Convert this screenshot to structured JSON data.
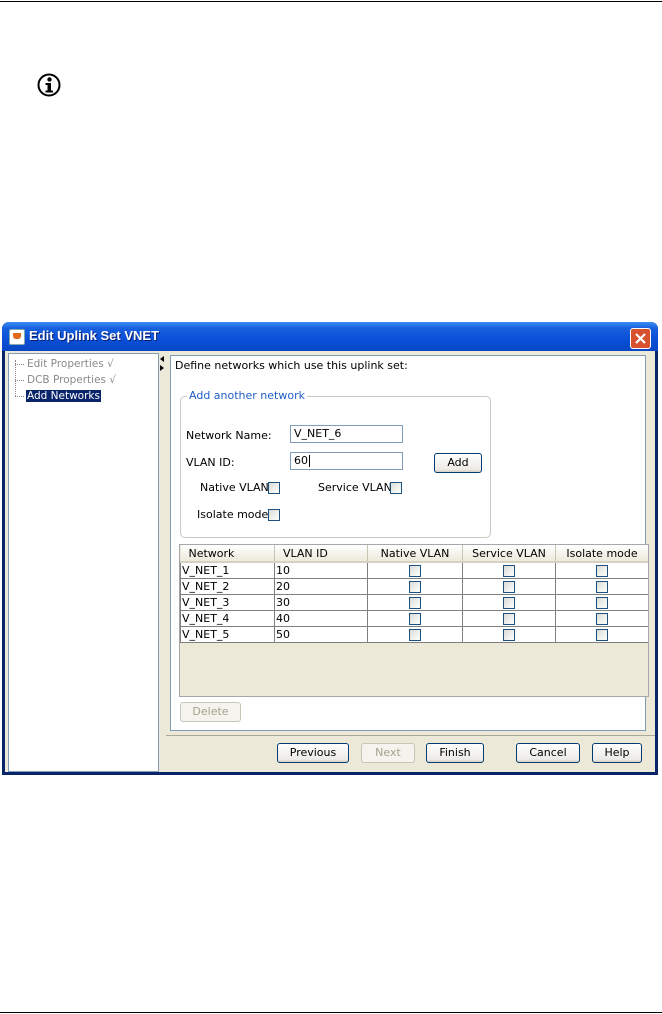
{
  "dialog": {
    "title": "Edit Uplink Set VNET"
  },
  "nav": {
    "items": [
      {
        "label": "Edit Properties √",
        "selected": false
      },
      {
        "label": "DCB Properties √",
        "selected": false
      },
      {
        "label": "Add Networks",
        "selected": true
      }
    ]
  },
  "panel": {
    "heading": "Define networks which use this uplink set:",
    "group_title": "Add another network",
    "network_name_label": "Network Name:",
    "network_name_value": "V_NET_6",
    "vlan_id_label": "VLAN ID:",
    "vlan_id_value": "60",
    "add_label": "Add",
    "native_vlan_label": "Native VLAN:",
    "service_vlan_label": "Service VLAN:",
    "isolate_mode_label": "Isolate mode:"
  },
  "table": {
    "columns": [
      "Network",
      "VLAN ID",
      "Native VLAN",
      "Service VLAN",
      "Isolate mode"
    ],
    "rows": [
      {
        "network": "V_NET_1",
        "vlan_id": "10",
        "native": false,
        "service": false,
        "isolate": false
      },
      {
        "network": "V_NET_2",
        "vlan_id": "20",
        "native": false,
        "service": false,
        "isolate": false
      },
      {
        "network": "V_NET_3",
        "vlan_id": "30",
        "native": false,
        "service": false,
        "isolate": false
      },
      {
        "network": "V_NET_4",
        "vlan_id": "40",
        "native": false,
        "service": false,
        "isolate": false
      },
      {
        "network": "V_NET_5",
        "vlan_id": "50",
        "native": false,
        "service": false,
        "isolate": false
      }
    ]
  },
  "buttons": {
    "delete": "Delete",
    "previous": "Previous",
    "next": "Next",
    "finish": "Finish",
    "cancel": "Cancel",
    "help": "Help"
  },
  "icons": {
    "info": "info-icon",
    "app": "java-app-icon",
    "close": "close-icon"
  },
  "colors": {
    "titlebar": "#0b4fd8",
    "selection": "#0a246a",
    "group_title": "#215dc6",
    "close_button": "#d7502f"
  }
}
